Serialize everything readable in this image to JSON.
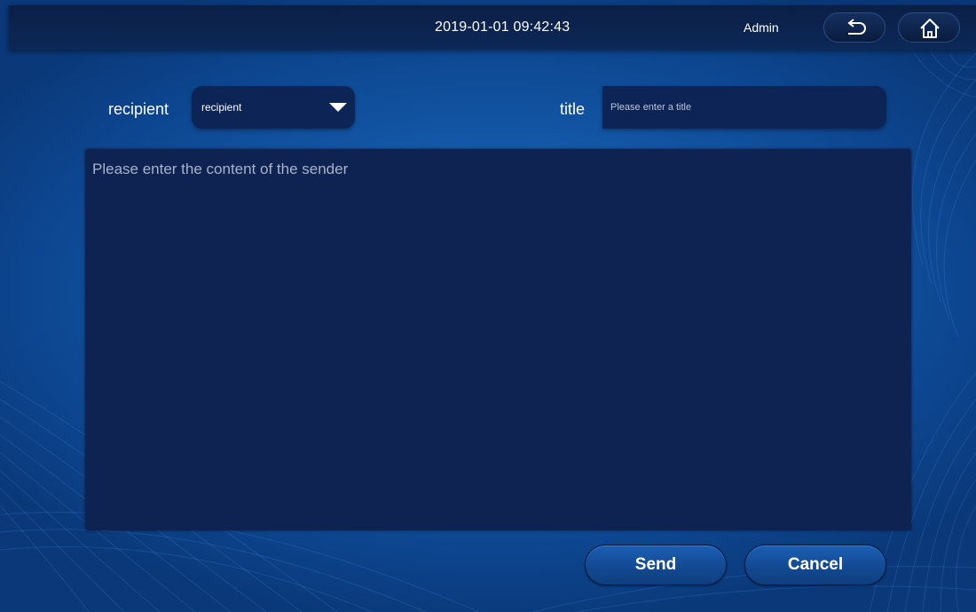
{
  "status_bar": {
    "datetime": "2019-01-01 09:42:43",
    "user": "Admin",
    "back_icon": "back-arrow-icon",
    "home_icon": "home-icon"
  },
  "form": {
    "recipient_label": "recipient",
    "recipient_value": "recipient",
    "title_label": "title",
    "title_placeholder": "Please enter a title",
    "content_placeholder": "Please enter the content of the sender"
  },
  "actions": {
    "send_label": "Send",
    "cancel_label": "Cancel"
  },
  "colors": {
    "background": "#145aaa",
    "topbar": "#0b1f45",
    "field": "#0d2556",
    "text": "#ffffff"
  }
}
